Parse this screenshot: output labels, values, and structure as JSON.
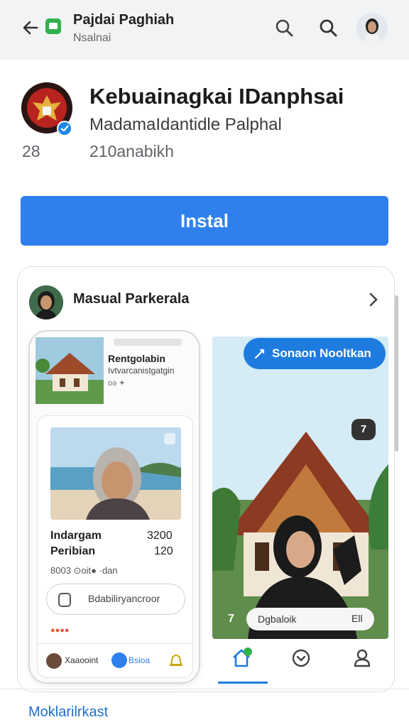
{
  "topbar": {
    "title": "Pajdai Paghiah",
    "subtitle": "Nsalnai",
    "icons": [
      "back-arrow-icon",
      "app-icon",
      "search-icon",
      "search-icon",
      "profile-avatar"
    ]
  },
  "app": {
    "title": "Kebuainagkai IDanphsai",
    "developer": "MadamаIdantidle Palphal",
    "stat_left": "28",
    "stat_right": "210anabikh",
    "install_label": "Instal"
  },
  "card": {
    "title": "Masual Parkerala",
    "phone": {
      "name": "Rentgolabin",
      "line1": "Ivtvarcanistgatgin",
      "line2": "ᴅ⁠⁠ə ✦",
      "label_a": "Indargam",
      "value_a": "3200",
      "label_b": "Peribian",
      "value_b": "120",
      "meta": "8003 ⊙oit● ·dan",
      "input_placeholder": "Bdabiliryancroor",
      "nav_label1": "Xaaooint",
      "nav_label2": "Bsioa"
    },
    "pill_label": "Sonaon Nooltkan",
    "bubble_label": "7",
    "search_text": "Dgbaloik",
    "search_num": "Ell",
    "seven_label": "7"
  },
  "bottom_link": "Moklarilrkast",
  "colors": {
    "accent": "#2f80ed",
    "pill": "#1e7be0",
    "link": "#1e6fd0",
    "topbar_bg": "#f1f3f5"
  }
}
